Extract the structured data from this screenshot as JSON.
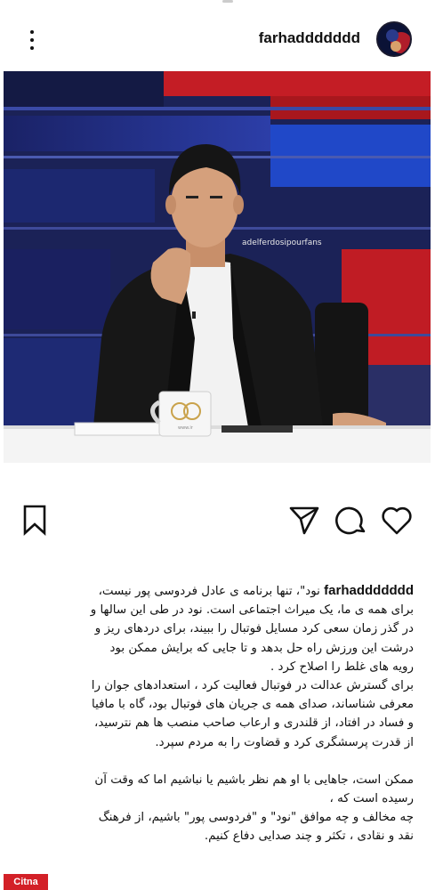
{
  "post": {
    "username": "farhaddddddd",
    "photo": {
      "overlay_handle": "adelferdosipourfans",
      "mug_logo_text": "www.ir"
    }
  },
  "icons": {
    "menu": "more-vertical-icon",
    "bookmark": "bookmark-icon",
    "share": "send-icon",
    "comment": "comment-icon",
    "like": "heart-icon"
  },
  "caption": {
    "username": "farhaddddddd",
    "line1": "نود\"، تنها برنامه ی عادل فردوسی پور نیست،",
    "line2": "برای همه ی ما، یک میراث اجتماعی است.  نود در طی این سالها و",
    "line3": "در گذر زمان سعی کرد مسایل فوتبال را ببیند، برای دردهای ریز و",
    "line4": "درشت این ورزش راه حل بدهد و تا جایی که برایش ممکن بود",
    "line5": "رویه های غلط را اصلاح کرد .",
    "line6": "برای گسترش عدالت در فوتبال فعالیت کرد ، استعدادهای جوان را",
    "line7": "معرفی شناساند،  صدای همه ی جریان های فوتبال بود، گاه با مافیا",
    "line8": "و فساد در افتاد، از قلندری و ارعاب  صاحب منصب ها هم  نترسید،",
    "line9": "از قدرت پرسشگری کرد و قضاوت را به مردم سپرد.",
    "line10": "ممکن است، جاهایی با او  هم نظر باشیم یا نباشیم  اما که وقت آن",
    "line11": "رسیده است که ،",
    "line12": "چه مخالف و چه موافق \"نود\" و \"فردوسی پور\" باشیم،  از فرهنگ",
    "line13": "نقد و نقادی ، تکثر و چند صدایی دفاع کنیم."
  },
  "watermark": "Citna",
  "colors": {
    "text": "#111111",
    "watermark_bg": "#d32027"
  }
}
